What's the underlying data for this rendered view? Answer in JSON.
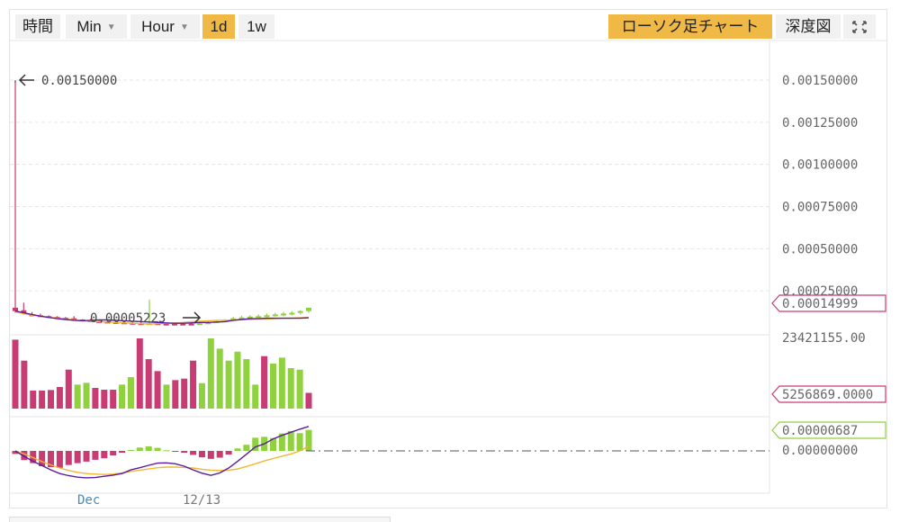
{
  "toolbar": {
    "time_label": "時間",
    "min_label": "Min",
    "hour_label": "Hour",
    "d1_label": "1d",
    "w1_label": "1w",
    "candle_label": "ローソク足チャート",
    "depth_label": "深度図",
    "colors": {
      "active": "#f0b945",
      "inactive": "#f1f1f1"
    }
  },
  "chart_data": [
    {
      "type": "candlestick",
      "panel": "price",
      "y_tick_labels": [
        "0.00150000",
        "0.00125000",
        "0.00100000",
        "0.00075000",
        "0.00050000",
        "0.00025000"
      ],
      "ylim": [
        0,
        0.0015
      ],
      "grid": true,
      "current_price_label": "0.00014999",
      "annotations": [
        {
          "text": "0.00150000",
          "type": "max"
        },
        {
          "text": "0.00005223",
          "type": "min"
        }
      ],
      "candles": [
        {
          "o": 0.00015,
          "h": 0.0015,
          "l": 0.00012,
          "c": 0.00013,
          "dir": "down"
        },
        {
          "o": 0.000135,
          "h": 0.00018,
          "l": 0.00011,
          "c": 0.000115,
          "dir": "down"
        },
        {
          "o": 0.00011,
          "h": 0.000125,
          "l": 0.0001,
          "c": 0.000105,
          "dir": "down"
        },
        {
          "o": 0.000105,
          "h": 0.000115,
          "l": 9.75e-05,
          "c": 0.0001,
          "dir": "down"
        },
        {
          "o": 0.0001,
          "h": 0.000105,
          "l": 9e-05,
          "c": 9.5e-05,
          "dir": "down"
        },
        {
          "o": 9.5e-05,
          "h": 0.0001,
          "l": 8.5e-05,
          "c": 9e-05,
          "dir": "down"
        },
        {
          "o": 9e-05,
          "h": 9.5e-05,
          "l": 8.25e-05,
          "c": 8.75e-05,
          "dir": "down"
        },
        {
          "o": 8.75e-05,
          "h": 0.0001,
          "l": 7.5e-05,
          "c": 8e-05,
          "dir": "down"
        },
        {
          "o": 8e-05,
          "h": 8.25e-05,
          "l": 7e-05,
          "c": 7.5e-05,
          "dir": "down"
        },
        {
          "o": 7.5e-05,
          "h": 8.5e-05,
          "l": 6.75e-05,
          "c": 7e-05,
          "dir": "down"
        },
        {
          "o": 7e-05,
          "h": 8e-05,
          "l": 6.25e-05,
          "c": 6.75e-05,
          "dir": "down"
        },
        {
          "o": 6.75e-05,
          "h": 7.25e-05,
          "l": 6e-05,
          "c": 6.5e-05,
          "dir": "down"
        },
        {
          "o": 6.5e-05,
          "h": 7e-05,
          "l": 5.75e-05,
          "c": 6.25e-05,
          "dir": "down"
        },
        {
          "o": 6.25e-05,
          "h": 6.75e-05,
          "l": 5.75e-05,
          "c": 6e-05,
          "dir": "down"
        },
        {
          "o": 6e-05,
          "h": 6.5e-05,
          "l": 5.25e-05,
          "c": 5.75e-05,
          "dir": "down"
        },
        {
          "o": 5.75e-05,
          "h": 6.5e-05,
          "l": 5e-05,
          "c": 5.5e-05,
          "dir": "down"
        },
        {
          "o": 5.5e-05,
          "h": 0.0001975,
          "l": 5e-05,
          "c": 5.75e-05,
          "dir": "up"
        },
        {
          "o": 5.75e-05,
          "h": 7e-05,
          "l": 5.25e-05,
          "c": 5.5e-05,
          "dir": "down"
        },
        {
          "o": 5.5e-05,
          "h": 6e-05,
          "l": 5e-05,
          "c": 5.25e-05,
          "dir": "down"
        },
        {
          "o": 5.25e-05,
          "h": 6.25e-05,
          "l": 5e-05,
          "c": 5.5e-05,
          "dir": "down"
        },
        {
          "o": 5.5e-05,
          "h": 6e-05,
          "l": 5e-05,
          "c": 5.25e-05,
          "dir": "down"
        },
        {
          "o": 5.25e-05,
          "h": 6.5e-05,
          "l": 4.75e-05,
          "c": 5.5e-05,
          "dir": "down"
        },
        {
          "o": 5.5e-05,
          "h": 6.5e-05,
          "l": 5.25e-05,
          "c": 5.75e-05,
          "dir": "up"
        },
        {
          "o": 5.75e-05,
          "h": 7e-05,
          "l": 5.25e-05,
          "c": 6.25e-05,
          "dir": "up"
        },
        {
          "o": 6.25e-05,
          "h": 7.5e-05,
          "l": 6e-05,
          "c": 7e-05,
          "dir": "up"
        },
        {
          "o": 7e-05,
          "h": 8.25e-05,
          "l": 6.75e-05,
          "c": 7.5e-05,
          "dir": "up"
        },
        {
          "o": 7.5e-05,
          "h": 9.5e-05,
          "l": 7.25e-05,
          "c": 8.75e-05,
          "dir": "up"
        },
        {
          "o": 8.75e-05,
          "h": 0.0001025,
          "l": 8.25e-05,
          "c": 9.25e-05,
          "dir": "up"
        },
        {
          "o": 9.25e-05,
          "h": 0.000105,
          "l": 8.5e-05,
          "c": 9.75e-05,
          "dir": "up"
        },
        {
          "o": 9.75e-05,
          "h": 0.00011,
          "l": 9e-05,
          "c": 0.0001,
          "dir": "up"
        },
        {
          "o": 0.0001,
          "h": 0.000115,
          "l": 9.25e-05,
          "c": 0.000105,
          "dir": "up"
        },
        {
          "o": 0.000105,
          "h": 0.00012,
          "l": 9.75e-05,
          "c": 0.00011,
          "dir": "up"
        },
        {
          "o": 0.00011,
          "h": 0.000125,
          "l": 0.0001,
          "c": 0.000115,
          "dir": "up"
        },
        {
          "o": 0.000115,
          "h": 0.00013,
          "l": 0.000105,
          "c": 0.00012,
          "dir": "up"
        },
        {
          "o": 0.00012,
          "h": 0.000135,
          "l": 0.00011,
          "c": 0.00013,
          "dir": "up"
        },
        {
          "o": 0.00013,
          "h": 0.00015,
          "l": 0.00012,
          "c": 0.00014999,
          "dir": "up"
        }
      ],
      "ma_yellow": [
        0.000125,
        0.000115,
        0.000105,
        0.0001,
        9.25e-05,
        8.75e-05,
        8.25e-05,
        7.75e-05,
        7.25e-05,
        7e-05,
        6.75e-05,
        6.5e-05,
        6.25e-05,
        6e-05,
        5.75e-05,
        5.5e-05,
        5.25e-05,
        5.5e-05,
        5.75e-05,
        6e-05,
        6.25e-05,
        6.75e-05,
        7e-05,
        7.25e-05,
        7.5e-05,
        7.5e-05,
        7.75e-05,
        8e-05,
        8e-05,
        8.25e-05,
        8.25e-05,
        8.5e-05,
        8.75e-05,
        8.75e-05,
        9e-05,
        9.25e-05
      ],
      "ma_purple": [
        0.00013,
        0.00012,
        0.00011,
        0.0001,
        9.25e-05,
        8.5e-05,
        8e-05,
        7.5e-05,
        7.25e-05,
        7.5e-05,
        7.75e-05,
        7.75e-05,
        7.5e-05,
        7.25e-05,
        7e-05,
        6.75e-05,
        6.5e-05,
        6.25e-05,
        6e-05,
        5.75e-05,
        5.75e-05,
        6e-05,
        6.25e-05,
        6.25e-05,
        6.5e-05,
        6.75e-05,
        7.5e-05,
        8e-05,
        8.5e-05,
        8.5e-05,
        8.75e-05,
        8.75e-05,
        8.75e-05,
        8.75e-05,
        8.75e-05,
        9e-05
      ]
    },
    {
      "type": "bar",
      "panel": "volume",
      "y_tick_labels": [
        "23421155.00"
      ],
      "current_value_label": "5256869.0000",
      "ylim": [
        0,
        23421155
      ],
      "values": [
        23000000,
        16000000,
        6000000,
        6000000,
        6200000,
        7200000,
        13000000,
        8000000,
        8600000,
        6900000,
        6300000,
        6300000,
        8000000,
        10500000,
        23421155,
        16500000,
        12500000,
        8000000,
        9500000,
        10000000,
        16000000,
        8500000,
        23421155,
        20000000,
        16000000,
        19000000,
        16500000,
        8000000,
        17500000,
        15000000,
        17000000,
        13500000,
        13000000,
        5256869
      ],
      "dirs": [
        "down",
        "down",
        "down",
        "down",
        "down",
        "down",
        "down",
        "up",
        "up",
        "down",
        "down",
        "down",
        "up",
        "up",
        "down",
        "down",
        "down",
        "up",
        "down",
        "down",
        "down",
        "up",
        "up",
        "up",
        "up",
        "up",
        "up",
        "up",
        "down",
        "up",
        "up",
        "up",
        "up",
        "down"
      ]
    },
    {
      "type": "macd",
      "panel": "macd",
      "y_tick_labels": [
        "0.00000000"
      ],
      "current_value_label": "0.00000687",
      "x_tick_labels": [
        "Dec",
        "12/13"
      ],
      "histogram": [
        -1.0,
        -3.0,
        -4.0,
        -5.0,
        -5.3,
        -5.5,
        -4.6,
        -4.0,
        -3.5,
        -2.9,
        -2.4,
        -1.5,
        -0.6,
        0.3,
        1.1,
        1.5,
        1.0,
        0.2,
        -0.3,
        -0.6,
        -1.3,
        -2.1,
        -2.6,
        -2.2,
        -1.2,
        0.8,
        2.0,
        4.3,
        4.6,
        4.2,
        5.7,
        6.5,
        5.8,
        6.87
      ],
      "dif": [
        0.0,
        -1.8,
        -3.4,
        -4.8,
        -6.2,
        -7.4,
        -8.1,
        -8.6,
        -8.8,
        -8.7,
        -8.3,
        -7.9,
        -7.4,
        -6.2,
        -5.5,
        -4.7,
        -4.0,
        -3.9,
        -4.2,
        -5.0,
        -6.2,
        -7.3,
        -8.0,
        -7.2,
        -5.6,
        -3.4,
        -1.1,
        1.3,
        2.3,
        3.9,
        5.1,
        6.1,
        7.1,
        8.0
      ],
      "dea": [
        0.0,
        -1.0,
        -2.2,
        -3.5,
        -4.6,
        -5.6,
        -6.4,
        -7.0,
        -7.4,
        -7.6,
        -7.7,
        -7.6,
        -7.2,
        -6.7,
        -6.3,
        -5.9,
        -5.5,
        -5.3,
        -5.3,
        -5.4,
        -5.6,
        -6.0,
        -6.3,
        -6.4,
        -6.3,
        -5.9,
        -5.1,
        -4.2,
        -3.3,
        -2.5,
        -1.7,
        -1.0,
        0.0,
        1.5
      ]
    }
  ],
  "colors": {
    "up": "#8fd13f",
    "down": "#c93b73",
    "ma_yellow": "#f2b632",
    "ma_purple": "#5a1c9e",
    "axis_text": "#666666",
    "grid": "#e4e4e4"
  }
}
